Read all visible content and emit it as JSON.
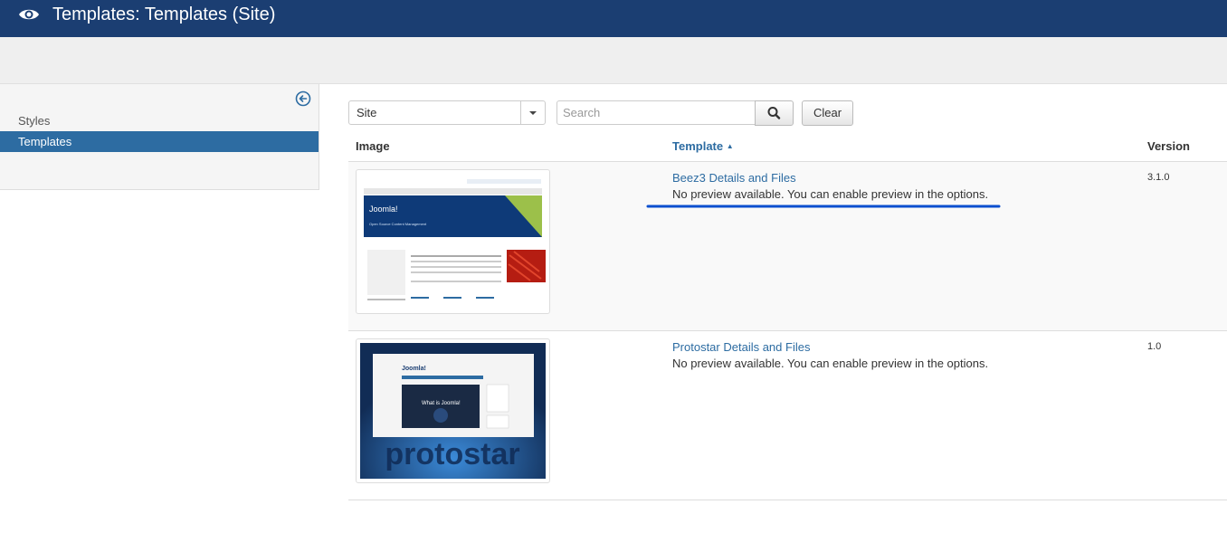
{
  "header": {
    "title": "Templates: Templates (Site)"
  },
  "sidebar": {
    "items": [
      {
        "label": "Styles"
      },
      {
        "label": "Templates"
      }
    ]
  },
  "filters": {
    "client_select_value": "Site",
    "search_placeholder": "Search",
    "clear_label": "Clear"
  },
  "table": {
    "columns": {
      "image": "Image",
      "template": "Template",
      "version": "Version"
    },
    "sort_indicator": "▲",
    "rows": [
      {
        "name": "Beez3 Details and Files",
        "note": "No preview available. You can enable preview in the options.",
        "version": "3.1.0"
      },
      {
        "name": "Protostar Details and Files",
        "note": "No preview available. You can enable preview in the options.",
        "version": "1.0"
      }
    ]
  },
  "thumbs": {
    "beez3": {
      "brand": "Joomla!",
      "tagline": "Open Source Content Management"
    },
    "protostar": {
      "brand": "Joomla!",
      "overlay": "What is Joomla!",
      "word": "protostar"
    }
  },
  "colors": {
    "header_bg": "#1b3e72",
    "accent": "#2d6ca2",
    "annotation": "#0b4fcf"
  }
}
